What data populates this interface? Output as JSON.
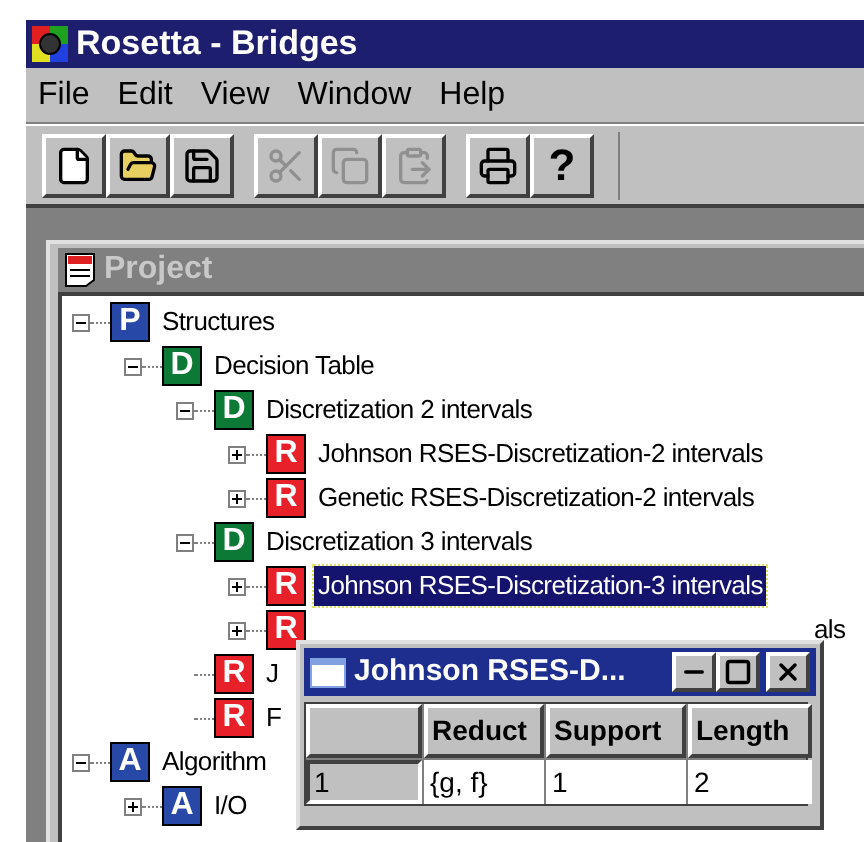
{
  "window": {
    "title": "Rosetta - Bridges"
  },
  "menu": [
    "File",
    "Edit",
    "View",
    "Window",
    "Help"
  ],
  "toolbar": [
    {
      "kind": "new",
      "disabled": false
    },
    {
      "kind": "open",
      "disabled": false
    },
    {
      "kind": "save",
      "disabled": false
    },
    {
      "kind": "cut",
      "disabled": true
    },
    {
      "kind": "copy",
      "disabled": true
    },
    {
      "kind": "paste",
      "disabled": true
    },
    {
      "kind": "print",
      "disabled": false
    },
    {
      "kind": "help",
      "disabled": false,
      "label": "?"
    }
  ],
  "project": {
    "title": "Project",
    "tree": [
      {
        "badge": "P",
        "color": "#2848a8",
        "label": "Structures",
        "expanded": true,
        "selected": false,
        "covered": false,
        "children": [
          {
            "badge": "D",
            "color": "#0c7a36",
            "label": "Decision Table",
            "expanded": true,
            "selected": false,
            "covered": false,
            "children": [
              {
                "badge": "D",
                "color": "#0c7a36",
                "label": "Discretization 2 intervals",
                "expanded": true,
                "selected": false,
                "covered": false,
                "children": [
                  {
                    "badge": "R",
                    "color": "#e8202a",
                    "label": "Johnson RSES-Discretization-2 intervals",
                    "expanded": false,
                    "selected": false,
                    "covered": false
                  },
                  {
                    "badge": "R",
                    "color": "#e8202a",
                    "label": "Genetic RSES-Discretization-2 intervals",
                    "expanded": false,
                    "selected": false,
                    "covered": false
                  }
                ]
              },
              {
                "badge": "D",
                "color": "#0c7a36",
                "label": "Discretization 3 intervals",
                "expanded": true,
                "selected": false,
                "covered": false,
                "children": [
                  {
                    "badge": "R",
                    "color": "#e8202a",
                    "label": "Johnson RSES-Discretization-3 intervals",
                    "expanded": false,
                    "selected": true,
                    "covered": false
                  },
                  {
                    "badge": "R",
                    "color": "#e8202a",
                    "label": "als",
                    "expanded": false,
                    "selected": false,
                    "covered": true
                  }
                ]
              },
              {
                "badge": "R",
                "color": "#e8202a",
                "label": "J",
                "selected": false,
                "covered": false
              },
              {
                "badge": "R",
                "color": "#e8202a",
                "label": "F",
                "selected": false,
                "covered": false
              }
            ]
          }
        ]
      },
      {
        "badge": "A",
        "color": "#2848a8",
        "label": "Algorithm",
        "expanded": true,
        "selected": false,
        "covered": false,
        "children": [
          {
            "badge": "A",
            "color": "#2848a8",
            "label": "I/O",
            "expanded": false,
            "selected": false,
            "covered": false
          }
        ]
      }
    ]
  },
  "popup": {
    "title": "Johnson RSES-D...",
    "columns": [
      "Reduct",
      "Support",
      "Length"
    ],
    "rows": [
      {
        "header": "1",
        "cells": [
          "{g, f}",
          "1",
          "2"
        ]
      }
    ]
  }
}
